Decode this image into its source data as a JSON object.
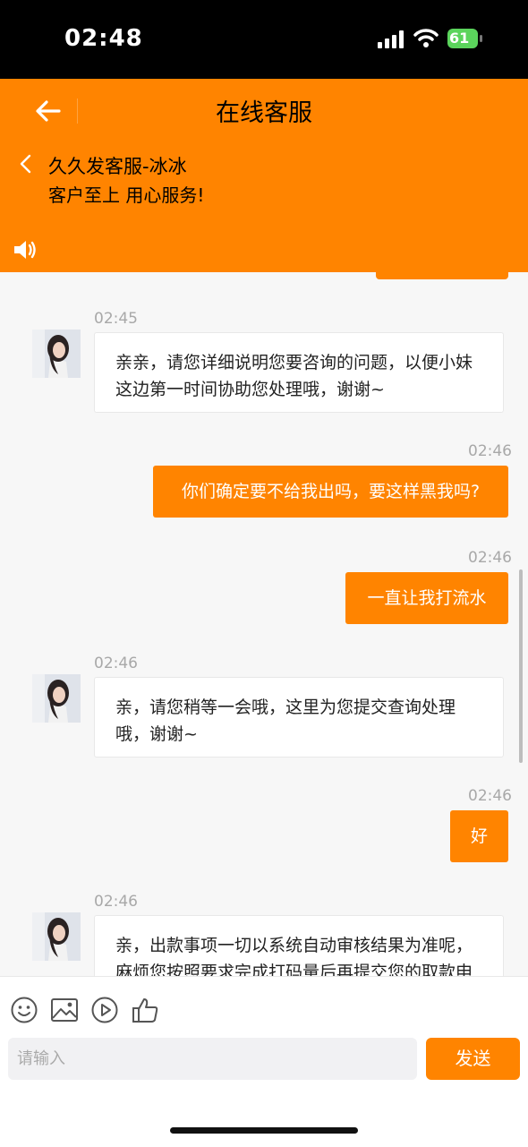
{
  "status_bar": {
    "time": "02:48",
    "battery": "61"
  },
  "header": {
    "title": "在线客服",
    "agent_name": "久久发客服-冰冰",
    "slogan": "客户至上 用心服务!"
  },
  "messages": [
    {
      "from": "agent",
      "time": "02:45",
      "text": "亲亲，请您详细说明您要咨询的问题，以便小妹这边第一时间协助您处理哦，谢谢~"
    },
    {
      "from": "user",
      "time": "02:46",
      "text": "你们确定要不给我出吗，要这样黑我吗?"
    },
    {
      "from": "user",
      "time": "02:46",
      "text": "一直让我打流水"
    },
    {
      "from": "agent",
      "time": "02:46",
      "text": "亲，请您稍等一会哦，这里为您提交查询处理哦，谢谢~"
    },
    {
      "from": "user",
      "time": "02:46",
      "text": "好"
    },
    {
      "from": "agent",
      "time": "02:46",
      "text": "亲，出款事项一切以系统自动审核结果为准呢，麻烦您按照要求完成打码量后再提交您的取款申"
    }
  ],
  "composer": {
    "placeholder": "请输入",
    "send_label": "发送",
    "tools": [
      "emoji-icon",
      "image-icon",
      "video-icon",
      "thumbs-up-icon"
    ]
  },
  "colors": {
    "accent": "#ff8400",
    "background": "#f7f7f7"
  }
}
